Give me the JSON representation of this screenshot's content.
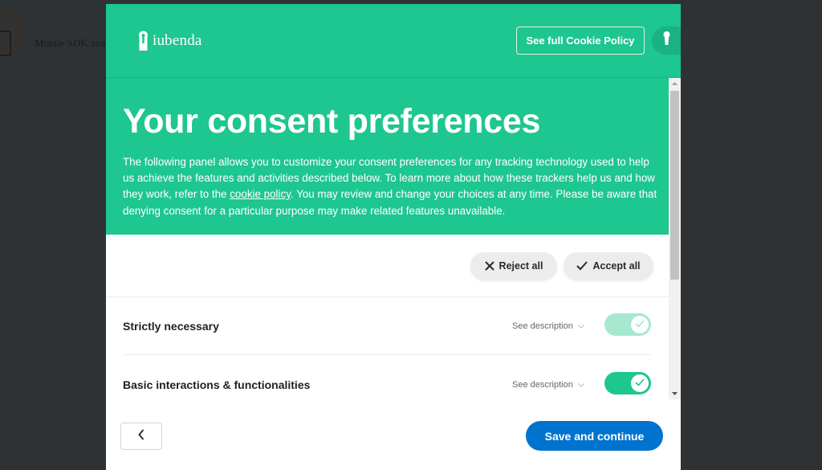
{
  "background_page": {
    "item_text": "Mobile SDK ava",
    "item_icon": "mobile-device-icon"
  },
  "modal": {
    "header": {
      "logo_text": "iubenda",
      "logo_icon": "iubenda-keyhole-icon",
      "policy_button_label": "See full Cookie Policy",
      "key_button_icon": "keyhole-icon"
    },
    "hero": {
      "title": "Your consent preferences",
      "text_before_link": "The following panel allows you to customize your consent preferences for any tracking technology used to help us achieve the features and activities described below. To learn more about how these trackers help us and how they work, refer to the ",
      "link_text": "cookie policy",
      "text_after_link": ". You may review and change your choices at any time. Please be aware that denying consent for a particular purpose may make related features unavailable."
    },
    "actions": {
      "reject_label": "Reject all",
      "reject_icon": "close-icon",
      "accept_label": "Accept all",
      "accept_icon": "check-icon"
    },
    "purposes": [
      {
        "title": "Strictly necessary",
        "description_label": "See description",
        "enabled": true,
        "locked": true
      },
      {
        "title": "Basic interactions & functionalities",
        "description_label": "See description",
        "enabled": true,
        "locked": false
      }
    ],
    "footer": {
      "back_icon": "chevron-left-icon",
      "save_label": "Save and continue"
    }
  },
  "colors": {
    "brand_green": "#1ec690",
    "toggle_locked": "#a6e8d0",
    "primary_blue": "#0073ce",
    "overlay": "#2e3235"
  }
}
